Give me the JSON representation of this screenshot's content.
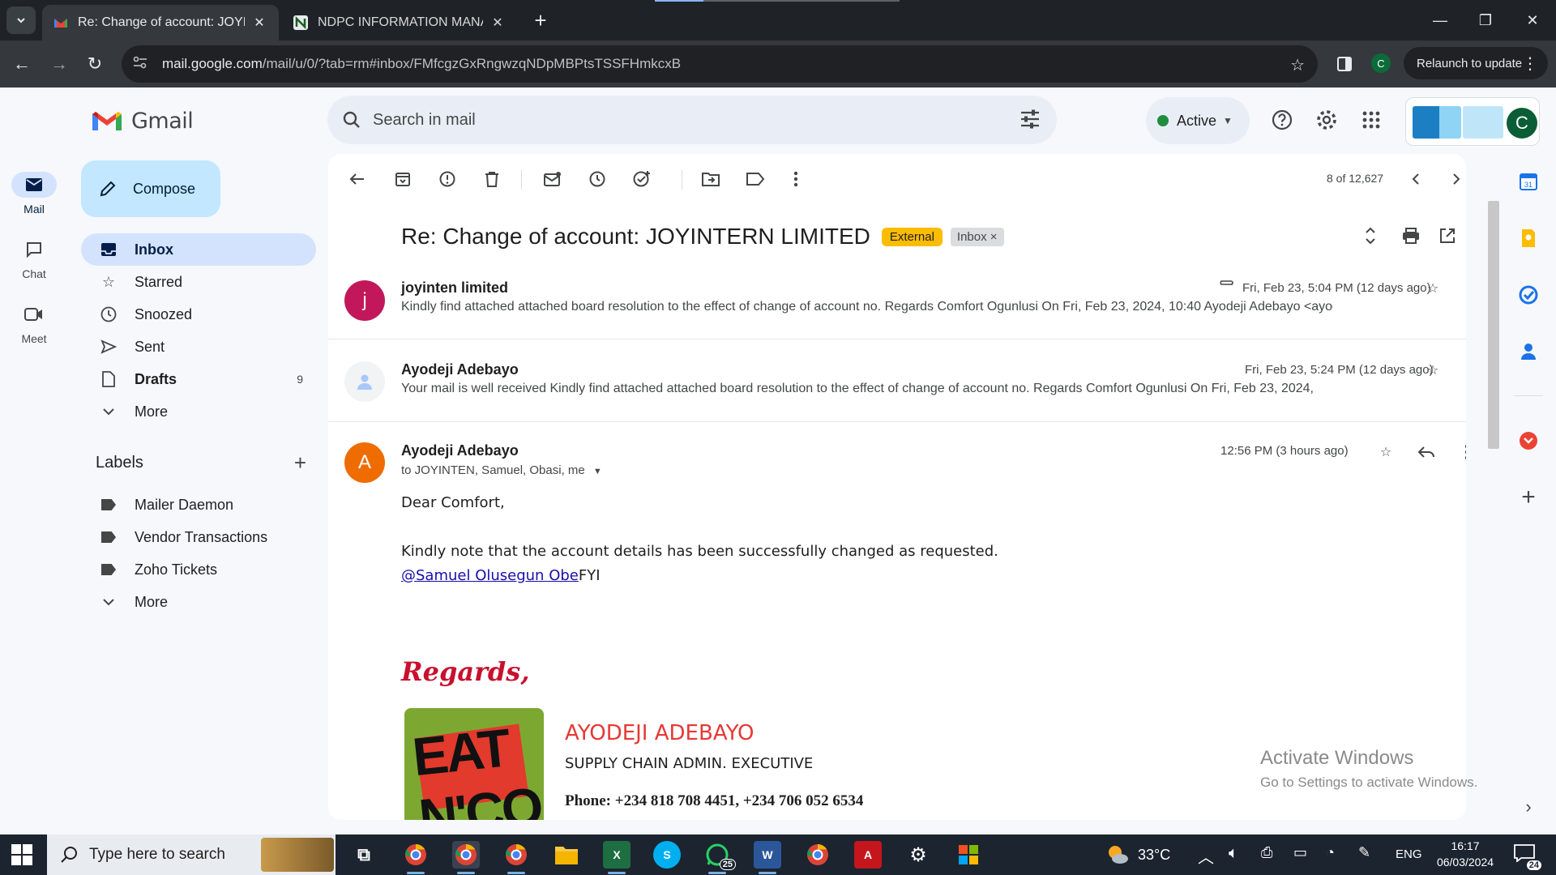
{
  "browser": {
    "tabs": [
      {
        "title": "Re: Change of account: JOYINTERN LIMITED",
        "active": true
      },
      {
        "title": "NDPC INFORMATION MANAGEMENT",
        "active": false
      }
    ],
    "url_host": "mail.google.com",
    "url_path": "/mail/u/0/?tab=rm#inbox/FMfcgzGxRngwzqNDpMBPtsTSSFHmkcxB",
    "profile_initial": "C",
    "relaunch_label": "Relaunch to update"
  },
  "gmail": {
    "brand": "Gmail",
    "search_placeholder": "Search in mail",
    "status": "Active",
    "account_initial": "C",
    "compose_label": "Compose",
    "rail": [
      {
        "label": "Mail",
        "icon": "mail-icon"
      },
      {
        "label": "Chat",
        "icon": "chat-icon"
      },
      {
        "label": "Meet",
        "icon": "video-icon"
      }
    ],
    "nav": [
      {
        "label": "Inbox",
        "icon": "inbox-icon",
        "active": true
      },
      {
        "label": "Starred",
        "icon": "star-icon"
      },
      {
        "label": "Snoozed",
        "icon": "clock-icon"
      },
      {
        "label": "Sent",
        "icon": "send-icon"
      },
      {
        "label": "Drafts",
        "icon": "draft-icon",
        "count": "9"
      },
      {
        "label": "More",
        "icon": "chevron-down-icon"
      }
    ],
    "labels_title": "Labels",
    "labels": [
      {
        "label": "Mailer Daemon"
      },
      {
        "label": "Vendor Transactions"
      },
      {
        "label": "Zoho Tickets"
      },
      {
        "label": "More"
      }
    ]
  },
  "thread": {
    "page_count": "8 of 12,627",
    "subject": "Re: Change of account: JOYINTERN LIMITED",
    "chip_external": "External",
    "chip_inbox": "Inbox",
    "chip_inbox_close": "×",
    "messages": [
      {
        "avatar": "j",
        "avatar_color": "#c2185b",
        "sender": "joyinten limited",
        "date": "Fri, Feb 23, 5:04 PM (12 days ago)",
        "snippet": "Kindly find attached attached board resolution to the effect of change of account no. Regards Comfort Ogunlusi On Fri, Feb 23, 2024, 10:40 Ayodeji Adebayo <ayod"
      },
      {
        "avatar": "",
        "avatar_color": "#e8eaed",
        "sender": "Ayodeji Adebayo",
        "date": "Fri, Feb 23, 5:24 PM (12 days ago)",
        "snippet": "Your mail is well received Kindly find attached attached board resolution to the effect of change of account no. Regards Comfort Ogunlusi On Fri, Feb 23, 2024,"
      },
      {
        "avatar": "A",
        "avatar_color": "#ef6c00",
        "sender": "Ayodeji Adebayo",
        "date": "12:56 PM (3 hours ago)",
        "to": "to JOYINTEN, Samuel, Obasi, me"
      }
    ],
    "body": {
      "greeting": "Dear Comfort,",
      "line1": "Kindly note that the account details has been successfully changed as requested.",
      "mention": "@Samuel Olusegun Obe",
      "mention_after": "FYI",
      "regards": "Regards,",
      "logo_text": "EAT N'CO",
      "sig_name": "AYODEJI ADEBAYO",
      "sig_title": "SUPPLY CHAIN ADMIN. EXECUTIVE",
      "sig_phone": "Phone: +234 818 708 4451, +234 706 052 6534"
    },
    "watermark": {
      "line1": "Activate Windows",
      "line2": "Go to Settings to activate Windows."
    }
  },
  "taskbar": {
    "search_placeholder": "Type here to search",
    "weather": "33°C",
    "lang": "ENG",
    "time": "16:17",
    "date": "06/03/2024",
    "notifications": "24",
    "whatsapp_badge": "25"
  },
  "colors": {
    "accent": "#0b57d0",
    "compose_bg": "#c2e7ff",
    "nav_active": "#d3e3fd",
    "external_chip": "#fbbc04"
  }
}
